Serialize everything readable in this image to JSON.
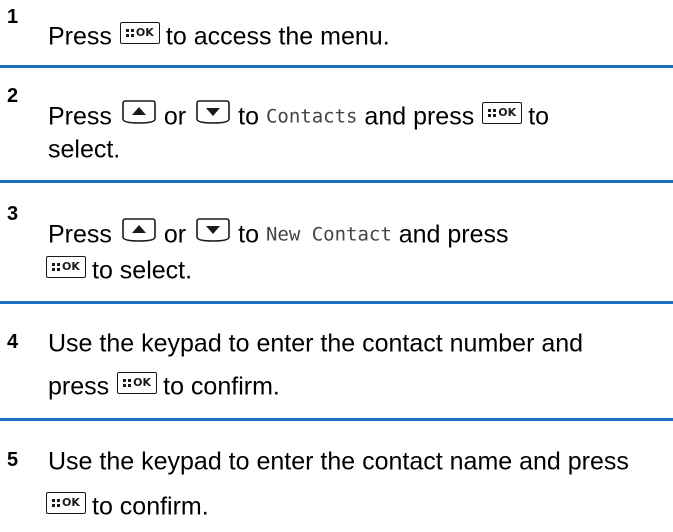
{
  "steps": [
    {
      "number": "1",
      "lines": [
        {
          "t1": "Press",
          "t2": "to access the menu."
        }
      ]
    },
    {
      "number": "2",
      "line1": {
        "t1": "Press",
        "t2": "or",
        "t3": "to",
        "code": "Contacts",
        "t4": "and press",
        "t5": "to"
      },
      "line2": {
        "t1": "select."
      }
    },
    {
      "number": "3",
      "line1": {
        "t1": "Press",
        "t2": "or",
        "t3": "to",
        "code": "New Contact",
        "t4": "and press"
      },
      "line2": {
        "t1": "to select."
      }
    },
    {
      "number": "4",
      "line1": {
        "t1": "Use the keypad to enter the contact number and"
      },
      "line2": {
        "t1": "press",
        "t2": "to confirm."
      }
    },
    {
      "number": "5",
      "line1": {
        "t1": "Use the keypad to enter the contact name and press"
      },
      "line2": {
        "t1": "to confirm."
      }
    }
  ],
  "icons": {
    "ok_key": "menu-ok-key-icon",
    "up_key": "navigation-up-key-icon",
    "down_key": "navigation-down-key-icon",
    "ok_key_text": "OK"
  },
  "colors": {
    "rule": "#1a71bf",
    "text": "#000000"
  }
}
